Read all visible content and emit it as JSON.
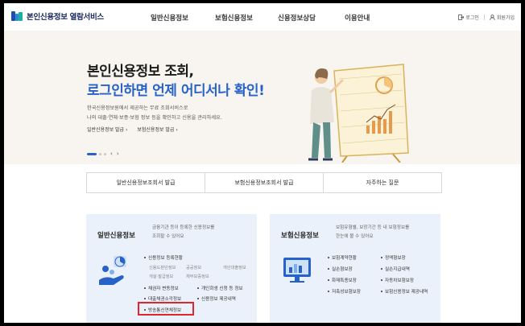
{
  "header": {
    "logo_text": "본인신용정보 열람서비스",
    "nav": [
      "일반신용정보",
      "보험신용정보",
      "신용정보상담",
      "이용안내"
    ],
    "login_label": "로그인",
    "join_label": "회원가입"
  },
  "hero": {
    "title_line1": "본인신용정보 조회,",
    "title_line2": "로그인하면 언제 어디서나 확인!",
    "desc_line1": "한국신용정보원에서 제공하는 무료 조회서비스로",
    "desc_line2": "나의 대출·연체·보증·보험 정보 등을 확인하고 신용을 관리하세요.",
    "links": [
      "일반신용정보 발급 ›",
      "보험신용정보 발급 ›"
    ],
    "pager_arrows": [
      "‹",
      "›"
    ]
  },
  "quick": [
    "일반신용정보조회서 발급",
    "보험신용정보조회서 발급",
    "자주하는 질문"
  ],
  "card_general": {
    "title": "일반신용정보",
    "desc_line1": "금융기관 등이 등록한 신용정보를",
    "desc_line2": "조회할 수 있어요",
    "items": {
      "status": "신용정보 등록현황",
      "sub1": "신용도판단정보",
      "sub2": "공공정보",
      "sub3": "개인대출정보",
      "sub4": "개설·발급정보",
      "sub5": "채무보증정보",
      "related": "채권자 변동정보",
      "personal": "개인회생 신청 등 정보",
      "loan": "대출채권소각정보",
      "provide": "신용정보 제공내역",
      "telecom": "방송통신연체정보"
    }
  },
  "card_insurance": {
    "title": "보험신용정보",
    "desc_line1": "보험유형별, 보장기간 등 내 보험정보를",
    "desc_line2": "한눈에 볼 수 있어요",
    "items": {
      "contract": "보험계약현황",
      "special": "정액형보장",
      "loss": "실손형보장",
      "payout": "실손지급내역",
      "car": "자동차보험보장",
      "fire": "화재특종보장",
      "savings": "저축성보험보장",
      "provide": "보험신용정보 제공내역"
    }
  },
  "colors": {
    "accent": "#2762c9",
    "card_bg": "#eaf1fa",
    "hero_bg": "#f8f5f0",
    "highlight": "#e0262b"
  }
}
